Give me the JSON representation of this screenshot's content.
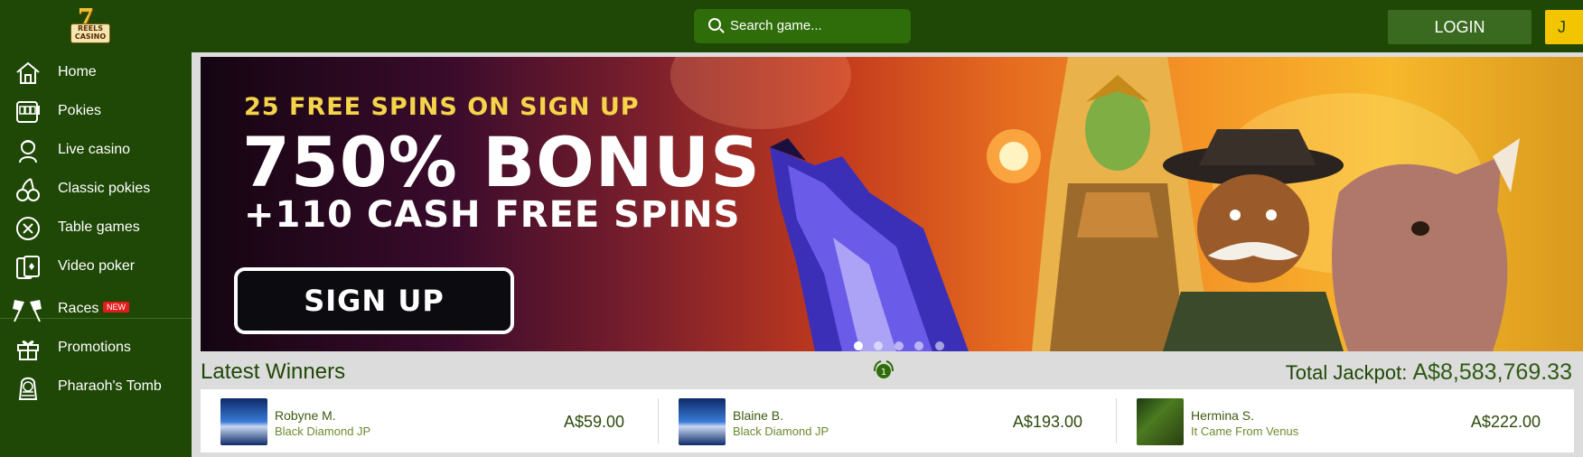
{
  "brand": {
    "logo_seven": "7",
    "logo_line1": "REELS",
    "logo_line2": "CASINO"
  },
  "header": {
    "search_placeholder": "Search game...",
    "login_label": "LOGIN",
    "join_label_visible": "J"
  },
  "sidebar": {
    "items": [
      {
        "label": "Home",
        "icon": "home-icon"
      },
      {
        "label": "Pokies",
        "icon": "slot-machine-icon"
      },
      {
        "label": "Live casino",
        "icon": "dealer-icon"
      },
      {
        "label": "Classic pokies",
        "icon": "cherries-icon"
      },
      {
        "label": "Table games",
        "icon": "roulette-chip-icon"
      },
      {
        "label": "Video poker",
        "icon": "cards-icon"
      },
      {
        "label": "Races",
        "icon": "checkered-flags-icon",
        "badge": "NEW"
      },
      {
        "label": "Promotions",
        "icon": "gift-icon"
      },
      {
        "label": "Pharaoh's Tomb",
        "icon": "pharaoh-icon"
      }
    ]
  },
  "banner": {
    "line1": "25 FREE SPINS ON SIGN UP",
    "line2": "750% BONUS",
    "line3": "+110 CASH FREE SPINS",
    "cta": "SIGN UP",
    "slides": 5,
    "active_slide": 1
  },
  "winners": {
    "title": "Latest Winners",
    "jackpot_label": "Total Jackpot:",
    "jackpot_amount": "A$8,583,769.33",
    "items": [
      {
        "name": "Robyne M.",
        "game": "Black Diamond JP",
        "amount": "A$59.00"
      },
      {
        "name": "Blaine B.",
        "game": "Black Diamond JP",
        "amount": "A$193.00"
      },
      {
        "name": "Hermina S.",
        "game": "It Came From Venus",
        "amount": "A$222.00"
      }
    ]
  },
  "colors": {
    "brand_green": "#1f4706",
    "accent_yellow": "#f2c500",
    "badge_red": "#e41b1b"
  }
}
